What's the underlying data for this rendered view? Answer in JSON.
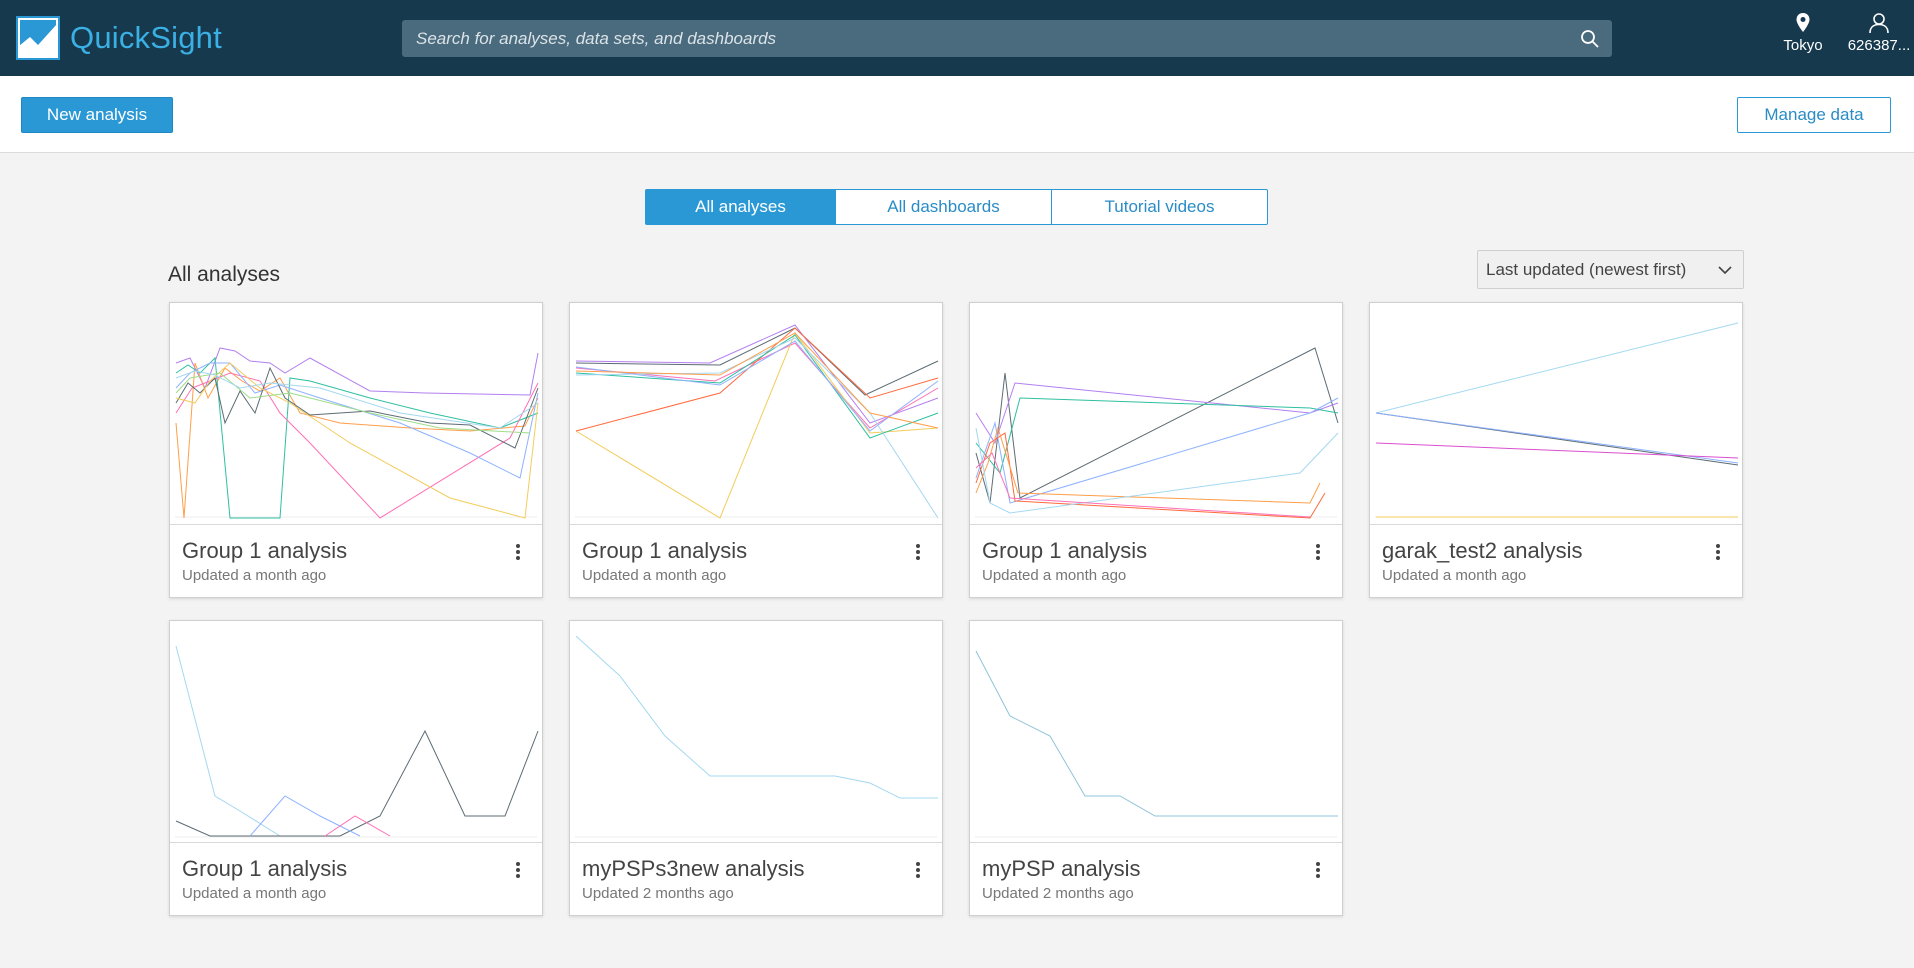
{
  "header": {
    "app_name": "QuickSight",
    "search_placeholder": "Search for analyses, data sets, and dashboards",
    "region_label": "Tokyo",
    "user_label": "626387..."
  },
  "actions": {
    "new_analysis_label": "New analysis",
    "manage_data_label": "Manage data"
  },
  "tabs": [
    {
      "label": "All analyses",
      "active": true
    },
    {
      "label": "All dashboards",
      "active": false
    },
    {
      "label": "Tutorial videos",
      "active": false
    }
  ],
  "main": {
    "section_title": "All analyses",
    "sort_selected": "Last updated (newest first)"
  },
  "analyses": [
    {
      "title": "Group 1 analysis",
      "updated": "Updated a month ago"
    },
    {
      "title": "Group 1 analysis",
      "updated": "Updated a month ago"
    },
    {
      "title": "Group 1 analysis",
      "updated": "Updated a month ago"
    },
    {
      "title": "garak_test2 analysis",
      "updated": "Updated a month ago"
    },
    {
      "title": "Group 1 analysis",
      "updated": "Updated a month ago"
    },
    {
      "title": "myPSPs3new analysis",
      "updated": "Updated 2 months ago"
    },
    {
      "title": "myPSP analysis",
      "updated": "Updated 2 months ago"
    }
  ],
  "colors": {
    "nav_bg": "#16394e",
    "brand_blue": "#3ab0e4",
    "accent": "#2a98d4",
    "page_bg": "#f3f3f3"
  }
}
